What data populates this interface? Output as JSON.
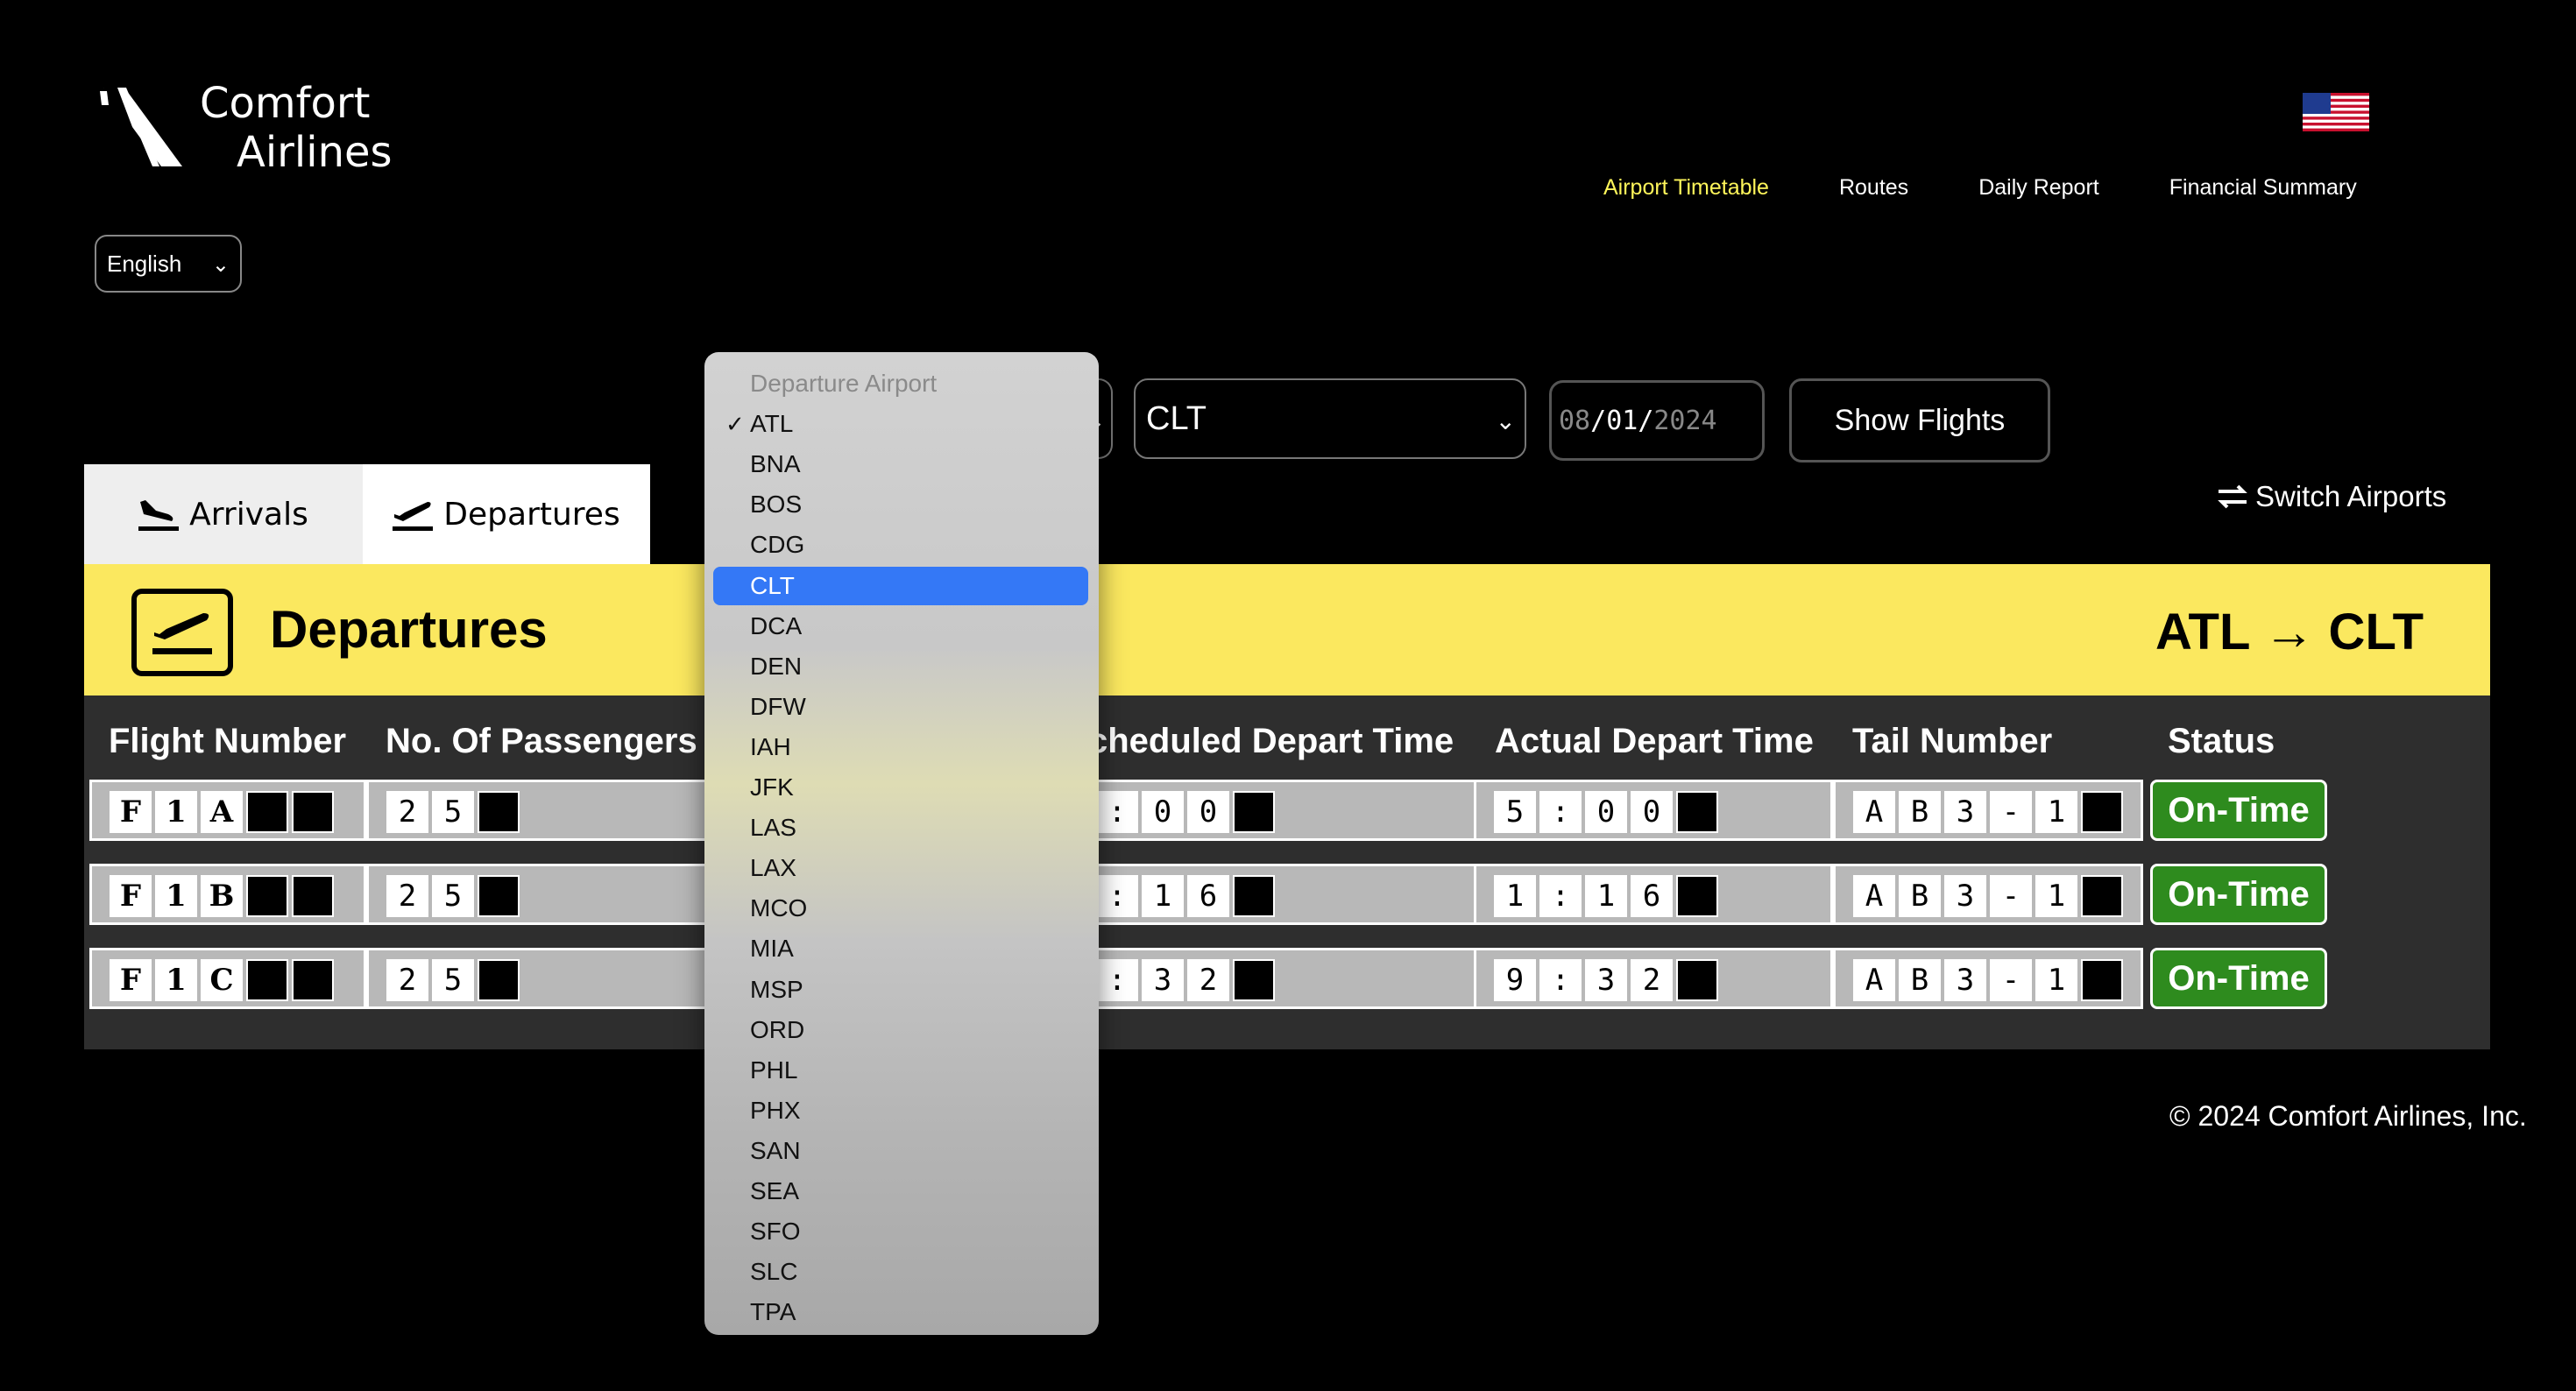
{
  "brand": {
    "line1": "Comfort",
    "line2": "Airlines"
  },
  "nav": [
    {
      "label": "Airport Timetable",
      "active": true
    },
    {
      "label": "Routes",
      "active": false
    },
    {
      "label": "Daily Report",
      "active": false
    },
    {
      "label": "Financial Summary",
      "active": false
    }
  ],
  "language": {
    "selected": "English"
  },
  "search": {
    "destination": "CLT",
    "date": {
      "month": "08",
      "day": "01",
      "year": "2024",
      "sep": "/"
    },
    "show_button": "Show Flights",
    "switch_label": "Switch Airports"
  },
  "tabs": {
    "arrivals": "Arrivals",
    "departures": "Departures"
  },
  "board": {
    "title": "Departures",
    "route": "ATL → CLT"
  },
  "table": {
    "headers": {
      "flight": "Flight Number",
      "passengers": "No. Of Passengers",
      "scheduled": "cheduled Depart Time",
      "actual": "Actual Depart Time",
      "tail": "Tail Number",
      "status": "Status"
    },
    "rows": [
      {
        "flight": [
          "F",
          "1",
          "A",
          "",
          ""
        ],
        "passengers": [
          "2",
          "5",
          ""
        ],
        "scheduled": [
          ":",
          "0",
          "0",
          ""
        ],
        "actual": [
          "5",
          ":",
          "0",
          "0",
          ""
        ],
        "tail": [
          "A",
          "B",
          "3",
          "-",
          "1",
          ""
        ],
        "status": "On-Time"
      },
      {
        "flight": [
          "F",
          "1",
          "B",
          "",
          ""
        ],
        "passengers": [
          "2",
          "5",
          ""
        ],
        "scheduled": [
          ":",
          "1",
          "6",
          ""
        ],
        "actual": [
          "1",
          ":",
          "1",
          "6",
          ""
        ],
        "tail": [
          "A",
          "B",
          "3",
          "-",
          "1",
          ""
        ],
        "status": "On-Time"
      },
      {
        "flight": [
          "F",
          "1",
          "C",
          "",
          ""
        ],
        "passengers": [
          "2",
          "5",
          ""
        ],
        "scheduled": [
          ":",
          "3",
          "2",
          ""
        ],
        "actual": [
          "9",
          ":",
          "3",
          "2",
          ""
        ],
        "tail": [
          "A",
          "B",
          "3",
          "-",
          "1",
          ""
        ],
        "status": "On-Time"
      }
    ]
  },
  "footer": "© 2024 Comfort Airlines, Inc.",
  "dropdown": {
    "placeholder": "Departure Airport",
    "checked": "ATL",
    "highlighted": "CLT",
    "options": [
      "ATL",
      "BNA",
      "BOS",
      "CDG",
      "CLT",
      "DCA",
      "DEN",
      "DFW",
      "IAH",
      "JFK",
      "LAS",
      "LAX",
      "MCO",
      "MIA",
      "MSP",
      "ORD",
      "PHL",
      "PHX",
      "SAN",
      "SEA",
      "SFO",
      "SLC",
      "TPA"
    ]
  },
  "colors": {
    "accent_yellow": "#fbe85f",
    "nav_active": "#fff65a",
    "status_green": "#2e8b1e",
    "select_blue": "#3478f6"
  }
}
